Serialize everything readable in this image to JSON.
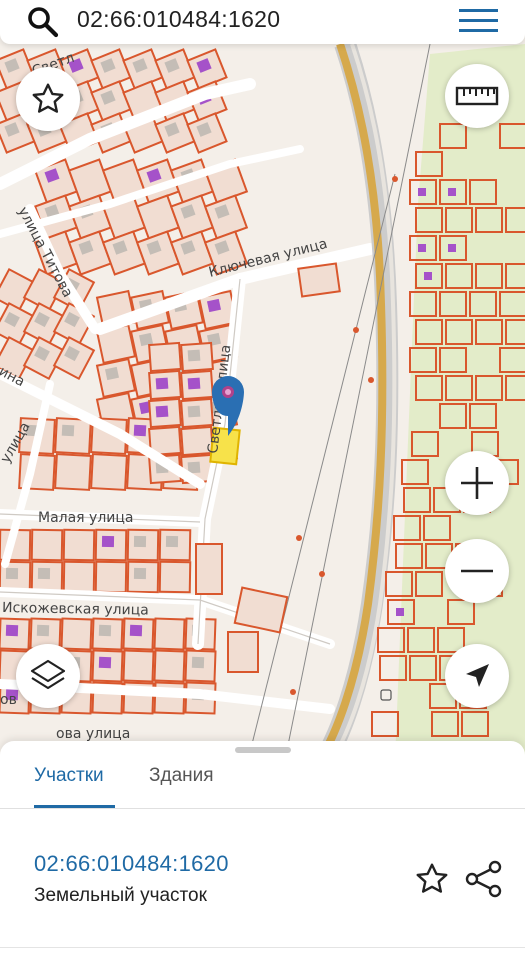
{
  "search": {
    "query": "02:66:010484:1620"
  },
  "map": {
    "streets": [
      {
        "id": "titova",
        "label": "улица Титова"
      },
      {
        "id": "klyuchevaya",
        "label": "Ключевая улица"
      },
      {
        "id": "malaya",
        "label": "Малая улица"
      },
      {
        "id": "iskozhevskaya",
        "label": "Искожевская улица"
      },
      {
        "id": "svetlaya-vert",
        "label": "Светлая улица"
      },
      {
        "id": "svetlaya-top",
        "label": "Светл"
      },
      {
        "id": "ulitsa-left",
        "label": "улица"
      },
      {
        "id": "ina",
        "label": "ина"
      },
      {
        "id": "bottom-partial",
        "label": "ова улица"
      },
      {
        "id": "bottom-left",
        "label": "ов"
      }
    ],
    "colors": {
      "background": "#f4efe9",
      "parcel_stroke": "#d9572d",
      "parcel_fill": "#f1ddd2",
      "building": "#c4bdb6",
      "purple_building": "#a552c9",
      "green_area": "#e3ecc9",
      "road_yellow": "#d6a94c",
      "selected_parcel": "#f7e24a",
      "marker": "#2a6fb3"
    }
  },
  "controls": {
    "favorite_icon": "star-outline-icon",
    "ruler_icon": "ruler-icon",
    "zoom_in_icon": "plus-icon",
    "zoom_out_icon": "minus-icon",
    "layers_icon": "layers-icon",
    "locate_icon": "navigation-arrow-icon"
  },
  "sheet": {
    "tabs": [
      {
        "label": "Участки",
        "active": true
      },
      {
        "label": "Здания",
        "active": false
      }
    ],
    "result": {
      "cadastral_id": "02:66:010484:1620",
      "type": "Земельный участок"
    }
  }
}
